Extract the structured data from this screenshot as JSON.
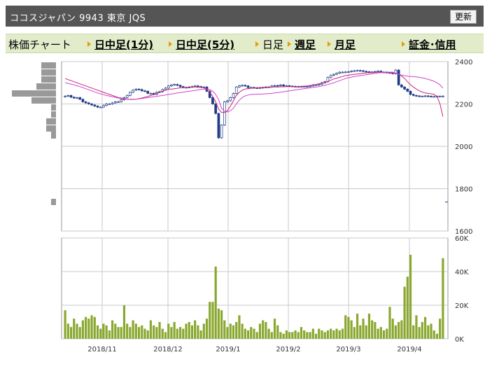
{
  "header": {
    "title": "ココスジャパン 9943 東京 JQS",
    "refresh_label": "更新"
  },
  "tabs": {
    "label": "株価チャート",
    "items": [
      {
        "label": "日中足(1分)",
        "type": "link"
      },
      {
        "label": "日中足(5分)",
        "type": "link"
      },
      {
        "label": "日足",
        "type": "current"
      },
      {
        "label": "週足",
        "type": "link"
      },
      {
        "label": "月足",
        "type": "link"
      },
      {
        "label": "証金･信用",
        "type": "link"
      }
    ]
  },
  "colors": {
    "candle_up": "#ffffff",
    "candle_down": "#1f3c88",
    "ma_short": "#cc2277",
    "ma_long": "#cc44cc",
    "volume": "#8aa830",
    "grid": "#c8c8c8",
    "profile": "#999999"
  },
  "chart_data": [
    {
      "type": "candlestick",
      "title": "",
      "y_ticks": [
        "2400",
        "2200",
        "2000",
        "1800",
        "1600"
      ],
      "ylim": [
        1600,
        2400
      ],
      "x_ticks": [
        "2018/11",
        "2018/12",
        "2019/1",
        "2019/2",
        "2019/3",
        "2019/4"
      ],
      "grid": true,
      "close": [
        2237,
        2240,
        2232,
        2228,
        2230,
        2222,
        2210,
        2205,
        2200,
        2195,
        2190,
        2185,
        2185,
        2193,
        2200,
        2200,
        2205,
        2210,
        2210,
        2220,
        2230,
        2240,
        2255,
        2265,
        2270,
        2268,
        2262,
        2260,
        2250,
        2250,
        2245,
        2255,
        2258,
        2268,
        2275,
        2285,
        2290,
        2292,
        2288,
        2282,
        2278,
        2278,
        2280,
        2282,
        2285,
        2282,
        2280,
        2280,
        2260,
        2230,
        2200,
        2155,
        2040,
        2100,
        2210,
        2215,
        2230,
        2250,
        2280,
        2286,
        2288,
        2285,
        2277,
        2278,
        2276,
        2275,
        2277,
        2278,
        2280,
        2280,
        2285,
        2287,
        2286,
        2290,
        2285,
        2286,
        2284,
        2283,
        2282,
        2282,
        2282,
        2282,
        2282,
        2285,
        2290,
        2290,
        2293,
        2300,
        2305,
        2325,
        2335,
        2340,
        2345,
        2350,
        2350,
        2351,
        2352,
        2355,
        2357,
        2358,
        2357,
        2354,
        2352,
        2350,
        2351,
        2353,
        2355,
        2350,
        2350,
        2348,
        2347,
        2343,
        2360,
        2290,
        2280,
        2270,
        2260,
        2245,
        2240,
        2238,
        2236,
        2236,
        2238,
        2236,
        2235,
        2235,
        2236,
        2236,
        2237
      ],
      "series": [
        {
          "name": "",
          "values": [
            2320,
            2315,
            2310,
            2305,
            2300,
            2295,
            2290,
            2285,
            2280,
            2275,
            2270,
            2265,
            2260,
            2255,
            2250,
            2245,
            2240,
            2235,
            2230,
            2228,
            2225,
            2222,
            2222,
            2222,
            2222,
            2225,
            2228,
            2232,
            2235,
            2240,
            2245,
            2250,
            2255,
            2260,
            2265,
            2268,
            2270,
            2272,
            2274,
            2276,
            2277,
            2278,
            2279,
            2280,
            2280,
            2279,
            2278,
            2276,
            2270,
            2255,
            2235,
            2210,
            2175,
            2160,
            2160,
            2168,
            2190,
            2215,
            2240,
            2255,
            2265,
            2270,
            2272,
            2274,
            2275,
            2276,
            2277,
            2278,
            2279,
            2280,
            2280,
            2280,
            2280,
            2281,
            2281,
            2282,
            2282,
            2282,
            2282,
            2282,
            2283,
            2284,
            2285,
            2287,
            2290,
            2292,
            2295,
            2298,
            2302,
            2306,
            2312,
            2318,
            2322,
            2326,
            2330,
            2334,
            2336,
            2338,
            2340,
            2341,
            2343,
            2345,
            2346,
            2347,
            2348,
            2349,
            2350,
            2350,
            2350,
            2349,
            2348,
            2346,
            2344,
            2340,
            2332,
            2320,
            2305,
            2290,
            2280,
            2270,
            2262,
            2256,
            2252,
            2250,
            2248,
            2245,
            2235,
            2200,
            2140
          ]
        },
        {
          "name": "",
          "values": [
            2300,
            2297,
            2294,
            2290,
            2286,
            2282,
            2277,
            2272,
            2267,
            2262,
            2257,
            2252,
            2248,
            2244,
            2240,
            2237,
            2234,
            2231,
            2228,
            2225,
            2223,
            2222,
            2221,
            2221,
            2222,
            2224,
            2226,
            2228,
            2230,
            2232,
            2234,
            2236,
            2238,
            2240,
            2242,
            2245,
            2247,
            2249,
            2252,
            2254,
            2256,
            2258,
            2260,
            2262,
            2264,
            2266,
            2268,
            2270,
            2270,
            2268,
            2260,
            2245,
            2220,
            2180,
            2165,
            2162,
            2168,
            2180,
            2200,
            2218,
            2230,
            2238,
            2242,
            2245,
            2246,
            2246,
            2246,
            2247,
            2248,
            2249,
            2250,
            2252,
            2254,
            2256,
            2258,
            2260,
            2262,
            2264,
            2266,
            2268,
            2270,
            2272,
            2274,
            2276,
            2278,
            2280,
            2282,
            2285,
            2288,
            2292,
            2296,
            2300,
            2305,
            2310,
            2315,
            2320,
            2324,
            2327,
            2330,
            2332,
            2334,
            2336,
            2338,
            2340,
            2342,
            2344,
            2346,
            2348,
            2349,
            2350,
            2350,
            2350,
            2345,
            2340,
            2336,
            2333,
            2331,
            2330,
            2329,
            2328,
            2326,
            2323,
            2320,
            2316,
            2312,
            2307,
            2300,
            2290,
            2275
          ]
        }
      ],
      "price_profile": [
        3,
        3,
        3,
        4,
        9,
        5,
        1,
        1,
        2,
        2,
        1
      ]
    },
    {
      "type": "bar",
      "title": "",
      "y_ticks": [
        "60K",
        "40K",
        "20K",
        "0K"
      ],
      "ylim": [
        0,
        60000
      ],
      "volume": [
        17000,
        9000,
        7000,
        12000,
        9000,
        7000,
        11000,
        13000,
        12000,
        14000,
        13000,
        8000,
        6000,
        9000,
        8000,
        5000,
        11000,
        9000,
        7000,
        7000,
        20000,
        9000,
        7000,
        11000,
        9000,
        7000,
        8000,
        6000,
        5000,
        11000,
        8000,
        7000,
        10000,
        6000,
        4000,
        9000,
        7000,
        10000,
        6000,
        7000,
        6000,
        9000,
        10000,
        8000,
        11000,
        8000,
        5000,
        9000,
        12000,
        22000,
        22000,
        43000,
        18000,
        17000,
        11000,
        7000,
        9000,
        8000,
        10000,
        14000,
        9000,
        6000,
        5000,
        7000,
        6000,
        4000,
        9000,
        11000,
        10000,
        6000,
        4000,
        12000,
        8000,
        4000,
        3000,
        5000,
        4000,
        4000,
        5000,
        4000,
        7000,
        5000,
        4000,
        4000,
        6000,
        3000,
        6000,
        5000,
        4000,
        5000,
        6000,
        5000,
        6000,
        5000,
        6000,
        14000,
        13000,
        11000,
        7000,
        15000,
        8000,
        12000,
        8000,
        15000,
        11000,
        10000,
        6000,
        7000,
        5000,
        6000,
        19000,
        12000,
        8000,
        10000,
        11000,
        31000,
        37000,
        50000,
        8000,
        14000,
        7000,
        10000,
        13000,
        8000,
        9000,
        5000,
        3000,
        12000,
        48000
      ]
    }
  ]
}
